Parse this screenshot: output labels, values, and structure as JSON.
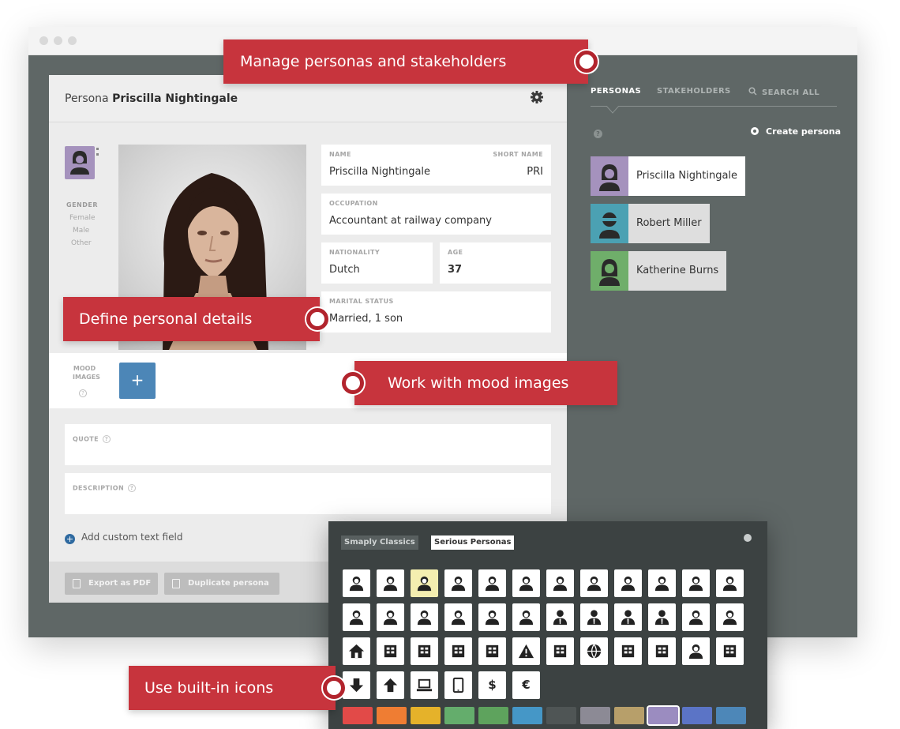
{
  "card": {
    "title_prefix": "Persona",
    "title_name": "Priscilla Nightingale",
    "gender_label": "GENDER",
    "gender_options": [
      "Female",
      "Male",
      "Other"
    ],
    "fields": {
      "name_label": "NAME",
      "name_value": "Priscilla Nightingale",
      "short_name_label": "SHORT NAME",
      "short_name_value": "PRI",
      "occupation_label": "OCCUPATION",
      "occupation_value": "Accountant at railway company",
      "nationality_label": "NATIONALITY",
      "nationality_value": "Dutch",
      "age_label": "AGE",
      "age_value": "37",
      "marital_label": "MARITAL STATUS",
      "marital_value": "Married, 1 son"
    },
    "mood_label_1": "MOOD",
    "mood_label_2": "IMAGES",
    "plus_label": "+",
    "help_glyph": "?",
    "quote_label": "QUOTE",
    "description_label": "DESCRIPTION",
    "add_custom_label": "Add custom text field",
    "export_label": "Export as PDF",
    "duplicate_label": "Duplicate persona"
  },
  "panel": {
    "tabs": [
      "PERSONAS",
      "STAKEHOLDERS",
      "SEARCH ALL"
    ],
    "active_tab": "PERSONAS",
    "create_label": "Create persona",
    "personas": [
      {
        "name": "Priscilla Nightingale",
        "color": "#a592bd",
        "selected": true
      },
      {
        "name": "Robert Miller",
        "color": "#4ba1b3",
        "selected": false
      },
      {
        "name": "Katherine Burns",
        "color": "#6fae6a",
        "selected": false
      }
    ]
  },
  "picker": {
    "tabs": [
      "Smaply Classics",
      "Serious Personas"
    ],
    "active_tab": "Serious Personas",
    "row1_icons": [
      "person-icon",
      "person-icon",
      "person-icon",
      "person-glasses-icon",
      "person-glasses-icon",
      "person-icon",
      "person-icon",
      "person-icon",
      "person-icon",
      "person-icon",
      "person-id-badge-icon",
      "group-icon"
    ],
    "row2_icons": [
      "person-icon",
      "person-icon",
      "person-icon",
      "person-icon",
      "person-hat-icon",
      "person-beard-icon",
      "person-suit-icon",
      "person-suit-icon",
      "person-tie-icon",
      "person-suit-icon",
      "graduate-icon",
      "idea-person-icon"
    ],
    "row3_icons": [
      "house-icon",
      "shop-icon",
      "office-building-icon",
      "scales-icon",
      "money-icon",
      "warning-icon",
      "truck-icon",
      "globe-icon",
      "wheelchair-icon",
      "cart-icon",
      "team-icon",
      "book-icon"
    ],
    "row4_icons": [
      "arrow-down-icon",
      "arrow-up-icon",
      "laptop-icon",
      "tablet-icon",
      "dollar-icon",
      "euro-icon"
    ],
    "dollar_glyph": "$",
    "euro_glyph": "€",
    "selected_icon_index": 2,
    "swatches": [
      "#e24a48",
      "#ef7d33",
      "#e5b22a",
      "#64ad6c",
      "#5ea35d",
      "#4597c7",
      "#4f5555",
      "#8c8a95",
      "#b79f6a",
      "#9b8cc0",
      "#5b74c6",
      "#4d87b8"
    ],
    "selected_swatch_index": 9
  },
  "callouts": {
    "manage": "Manage personas and stakeholders",
    "define": "Define personal details",
    "mood": "Work with mood images",
    "icons": "Use built-in icons"
  },
  "colors": {
    "accent_red": "#c7343d",
    "panel_bg": "#5f6766",
    "picker_bg": "#3c4242",
    "primary_blue": "#4c86b7"
  }
}
